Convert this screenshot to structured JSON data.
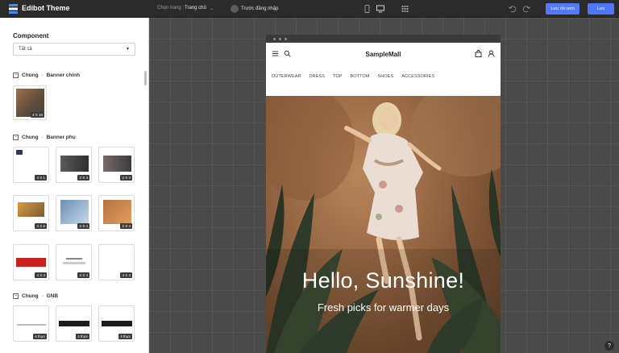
{
  "app": {
    "title": "Edibot Theme"
  },
  "toolbar": {
    "page_select_label": "Chọn trang :",
    "page_select_value": "Trang chủ",
    "preview_login": "Trước đăng nhập",
    "save_view_label": "Lưu rồi xem",
    "save_label": "Lưu"
  },
  "sidebar": {
    "title": "Component",
    "filter_value": "Tất cả",
    "sections": [
      {
        "group": "Chung",
        "name": "Banner chính",
        "items": [
          {
            "badge": "4 X 10"
          }
        ]
      },
      {
        "group": "Chung",
        "name": "Banner phụ",
        "items": [
          {
            "badge": "4 X 1"
          },
          {
            "badge": "2 X 4"
          },
          {
            "badge": "2 X 4"
          },
          {
            "badge": "4 X 6"
          },
          {
            "badge": "2 X 4"
          },
          {
            "badge": "2 X 4"
          },
          {
            "badge": "4 X 4"
          },
          {
            "badge": "4 X 4"
          },
          {
            "badge": "4 X 4"
          }
        ]
      },
      {
        "group": "Chung",
        "name": "GNB",
        "items": [
          {
            "badge": "4 thực"
          },
          {
            "badge": "4 thực"
          },
          {
            "badge": "4 thực"
          }
        ]
      }
    ]
  },
  "preview": {
    "shop_name": "SampleMall",
    "nav": [
      "OUTERWEAR",
      "DRESS",
      "TOP",
      "BOTTOM",
      "SHOES",
      "ACCESSORIES"
    ],
    "hero_title": "Hello, Sunshine!",
    "hero_subtitle": "Fresh picks for warmer days"
  },
  "help": {
    "label": "?"
  },
  "colors": {
    "primary": "#4f76f6",
    "topbar": "#2b2b2b",
    "canvas": "#4a4a4a"
  }
}
